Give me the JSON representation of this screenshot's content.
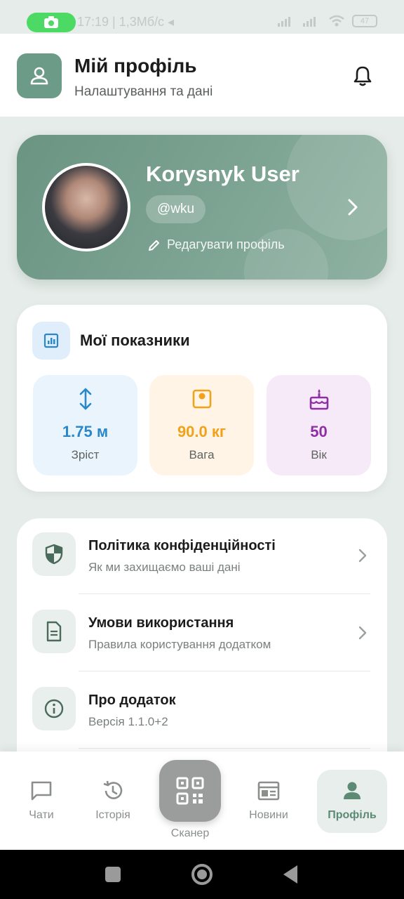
{
  "status_bar": {
    "time_info": "17:19 | 1,3Мб/с ◂",
    "battery": "47"
  },
  "header": {
    "title": "Мій профіль",
    "subtitle": "Налаштування та дані"
  },
  "profile": {
    "name": "Korysnyk User",
    "handle": "@wku",
    "edit_label": "Редагувати профіль"
  },
  "metrics": {
    "title": "Мої показники",
    "items": [
      {
        "value": "1.75 м",
        "label": "Зріст",
        "color": "#2a88c8",
        "bg": "#eaf4fd",
        "icon": "height-arrows-icon"
      },
      {
        "value": "90.0 кг",
        "label": "Вага",
        "color": "#f0a21a",
        "bg": "#fff4e5",
        "icon": "scale-icon"
      },
      {
        "value": "50",
        "label": "Вік",
        "color": "#8e2fa3",
        "bg": "#f6e9f8",
        "icon": "cake-icon"
      }
    ]
  },
  "menu": {
    "items": [
      {
        "title": "Політика конфіденційності",
        "subtitle": "Як ми захищаємо ваші дані"
      },
      {
        "title": "Умови використання",
        "subtitle": "Правила користування додатком"
      },
      {
        "title": "Про додаток",
        "subtitle": "Версія 1.1.0+2"
      }
    ]
  },
  "nav": {
    "chats": "Чати",
    "history": "Історія",
    "scanner": "Сканер",
    "news": "Новини",
    "profile": "Профіль"
  },
  "colors": {
    "accent": "#6c9b88",
    "active_nav": "#5c8a75"
  }
}
